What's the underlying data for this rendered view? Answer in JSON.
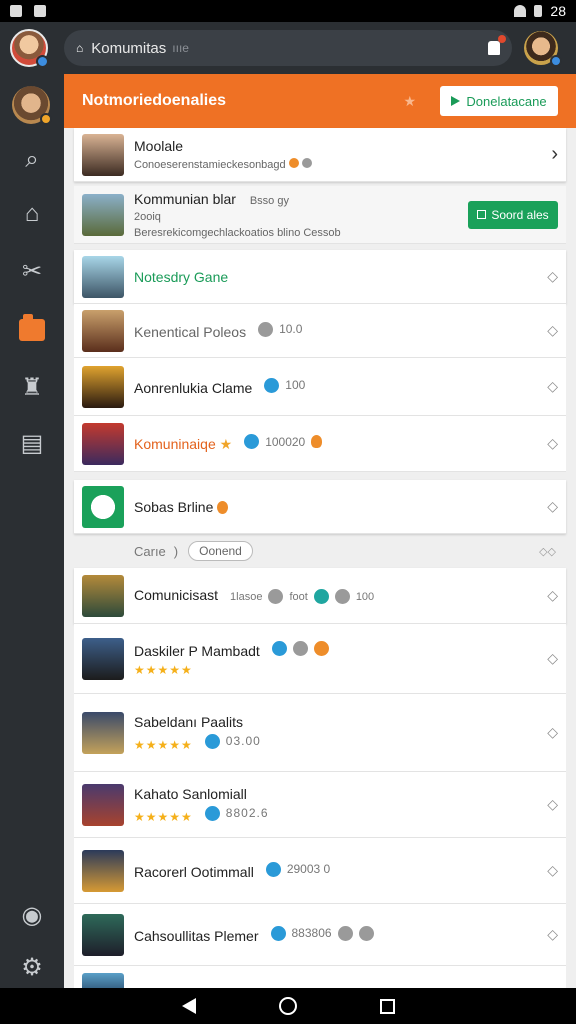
{
  "status": {
    "time": "28"
  },
  "appbar": {
    "search_text": "Komumitas",
    "search_hint": "ıııe"
  },
  "header": {
    "title": "Notmoriedoenalies",
    "download_label": "Donelatacane"
  },
  "featured": [
    {
      "name": "Moolale",
      "sub": "Conoeserenstamieckesonbagd"
    },
    {
      "name": "Kommunian blar",
      "badge": "Bsso gy",
      "meta": "2ooiq",
      "sub": "Beresrekicomgechlackoatios blino Cessob",
      "join_label": "Soord ales"
    }
  ],
  "groups": [
    {
      "name": "Notesdry Gane",
      "style": "green"
    },
    {
      "name": "Kenentical Poleos",
      "value": "10.0",
      "dot": "grey"
    },
    {
      "name": "Aonrenlukia Clame",
      "value": "100",
      "dot": "blue"
    },
    {
      "name": "Komuninaiqe",
      "value": "100020",
      "dot": "blue",
      "style": "orange"
    },
    {
      "name": "Sobas Brline"
    }
  ],
  "filter": {
    "label": "Carıe",
    "pill": "Oonend"
  },
  "list": [
    {
      "name": "Comunicisast",
      "meta": "1lasoe",
      "meta2": "foot",
      "value": "100"
    },
    {
      "name": "Daskiler P Mambadt",
      "rating": "★★★★★"
    },
    {
      "name": "Sabeldanı Paalits",
      "rating": "★★★★★",
      "value": "03.00"
    },
    {
      "name": "Kahato Sanlomiall",
      "rating": "★★★★★",
      "value": "8802.6"
    },
    {
      "name": "Racorerl Ootimmall",
      "value": "29003 0"
    },
    {
      "name": "Cahsoullitas Plemer",
      "value": "883806"
    }
  ],
  "colors": {
    "accent": "#ef7124",
    "green": "#1aa15a",
    "rail": "#2b2f33"
  }
}
